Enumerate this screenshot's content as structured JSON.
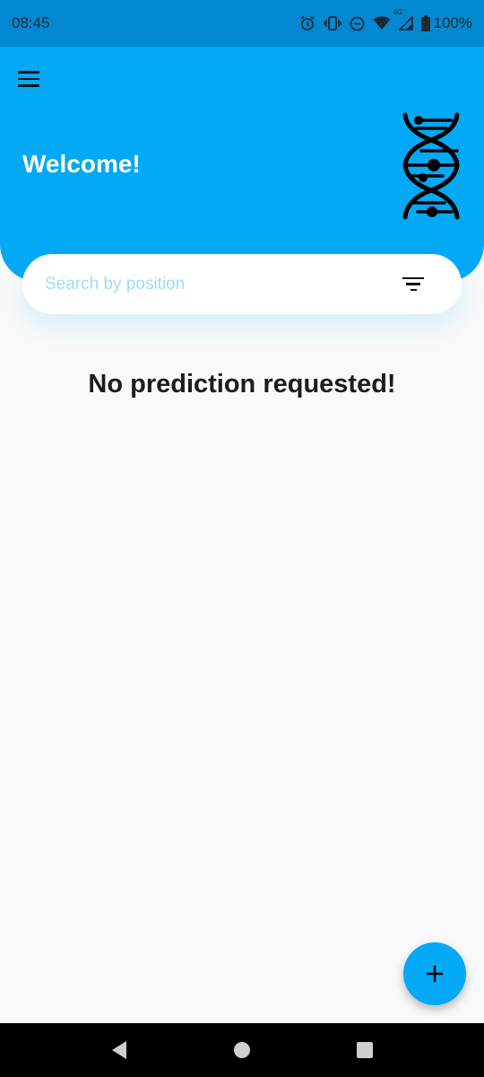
{
  "status_bar": {
    "time": "08:45",
    "battery": "100%",
    "network_label": "4G",
    "icons": [
      "alarm-icon",
      "vibrate-icon",
      "do-not-disturb-icon",
      "wifi-icon",
      "signal-icon",
      "battery-icon"
    ]
  },
  "header": {
    "title": "Welcome!",
    "menu_icon": "menu-icon",
    "logo_icon": "dna-icon",
    "background_color": "#03a9f4"
  },
  "search": {
    "placeholder": "Search by position",
    "value": "",
    "filter_icon": "filter-icon"
  },
  "main": {
    "empty_message": "No prediction requested!"
  },
  "fab": {
    "icon": "plus-icon",
    "color": "#03a9f4"
  },
  "nav_bar": {
    "buttons": [
      "back-icon",
      "home-icon",
      "recents-icon"
    ]
  }
}
